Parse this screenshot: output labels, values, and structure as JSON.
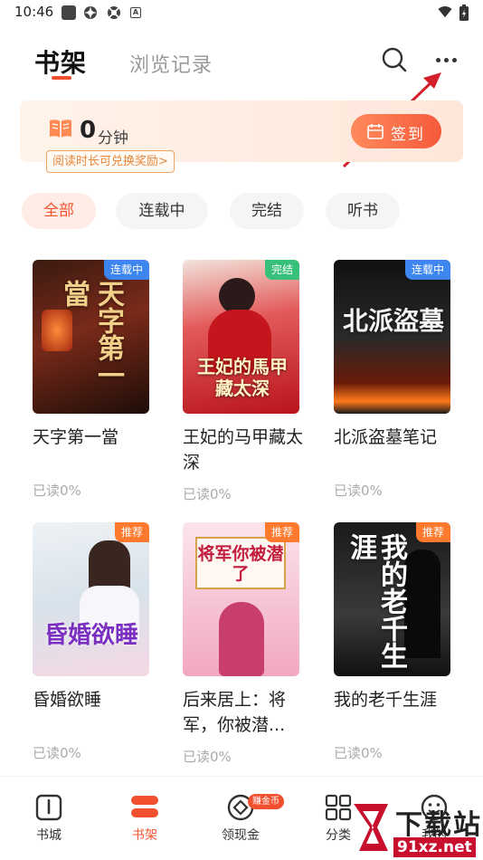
{
  "status_bar": {
    "time": "10:46",
    "a_icon": "A"
  },
  "header": {
    "tab_shelf": "书架",
    "tab_history": "浏览记录"
  },
  "reading": {
    "minutes": "0",
    "unit": "分钟",
    "redeem_tip": "阅读时长可兑换奖励>",
    "signin": "签到"
  },
  "filters": [
    "全部",
    "连载中",
    "完结",
    "听书"
  ],
  "books": [
    {
      "name": "天字第一當",
      "badge": "连载中",
      "progress": "已读0%",
      "cover_text": "天字第一當"
    },
    {
      "name": "王妃的马甲藏太深",
      "badge": "完结",
      "progress": "已读0%",
      "cover_text": "王妃的馬甲藏太深"
    },
    {
      "name": "北派盗墓笔记",
      "badge": "连载中",
      "progress": "已读0%",
      "cover_text": "北派盜墓"
    },
    {
      "name": "昏婚欲睡",
      "badge": "推荐",
      "progress": "已读0%",
      "cover_text": "昏婚欲睡"
    },
    {
      "name": "后来居上：将军，你被潜...",
      "badge": "推荐",
      "progress": "已读0%",
      "cover_text": "将军你被潜了"
    },
    {
      "name": "我的老千生涯",
      "badge": "推荐",
      "progress": "已读0%",
      "cover_text": "我的老千生涯"
    }
  ],
  "bottom_nav": {
    "items": [
      {
        "label": "书城",
        "icon": "book-store-icon"
      },
      {
        "label": "书架",
        "icon": "bookshelf-icon"
      },
      {
        "label": "领现金",
        "icon": "cash-icon"
      },
      {
        "label": "分类",
        "icon": "category-icon"
      },
      {
        "label": "我的",
        "icon": "profile-icon"
      }
    ],
    "cash_badge": "赚金币"
  },
  "watermark": {
    "title": "下载站",
    "domain": "91xz.net"
  },
  "colors": {
    "accent": "#f24f2f",
    "badge_serial": "#3d86f0",
    "badge_done": "#36c07a",
    "badge_recommend": "#ff7a2e"
  }
}
